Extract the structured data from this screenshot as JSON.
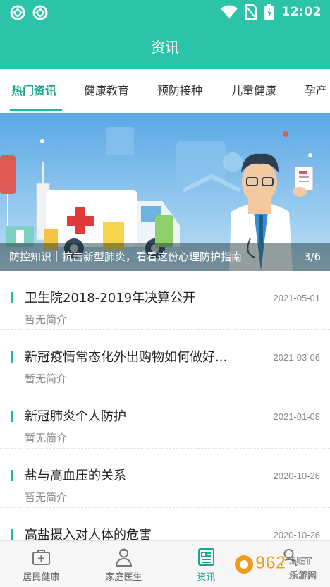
{
  "status_bar": {
    "time": "12:02",
    "icons": [
      "app-notify-icon",
      "app-notify-icon",
      "wifi-icon",
      "no-sim-icon",
      "battery-charging-icon"
    ]
  },
  "header": {
    "title": "资讯"
  },
  "tabs": [
    {
      "label": "热门资讯",
      "active": true
    },
    {
      "label": "健康教育",
      "active": false
    },
    {
      "label": "预防接种",
      "active": false
    },
    {
      "label": "儿童健康",
      "active": false
    },
    {
      "label": "孕产",
      "active": false
    }
  ],
  "banner": {
    "caption": "防控知识｜抗击新型肺炎，看看这份心理防护指南",
    "index": "3/6"
  },
  "news": [
    {
      "title": "卫生院2018-2019年决算公开",
      "date": "2021-05-01",
      "summary": "暂无简介"
    },
    {
      "title": "新冠疫情常态化外出购物如何做好...",
      "date": "2021-03-06",
      "summary": "暂无简介"
    },
    {
      "title": "新冠肺炎个人防护",
      "date": "2021-01-08",
      "summary": "暂无简介"
    },
    {
      "title": "盐与高血压的关系",
      "date": "2020-10-26",
      "summary": "暂无简介"
    },
    {
      "title": "高盐摄入对人体的危害",
      "date": "2020-10-26",
      "summary": ""
    }
  ],
  "bottom_nav": [
    {
      "label": "居民健康",
      "icon": "medical-kit-icon",
      "active": false
    },
    {
      "label": "家庭医生",
      "icon": "doctor-icon",
      "active": false
    },
    {
      "label": "资讯",
      "icon": "news-icon",
      "active": true
    },
    {
      "label": "",
      "icon": "user-icon",
      "active": false
    }
  ],
  "watermark": {
    "text": "962.NET",
    "subtext": "乐游网"
  },
  "colors": {
    "primary": "#2bc4a9",
    "accent": "#15a88e"
  }
}
